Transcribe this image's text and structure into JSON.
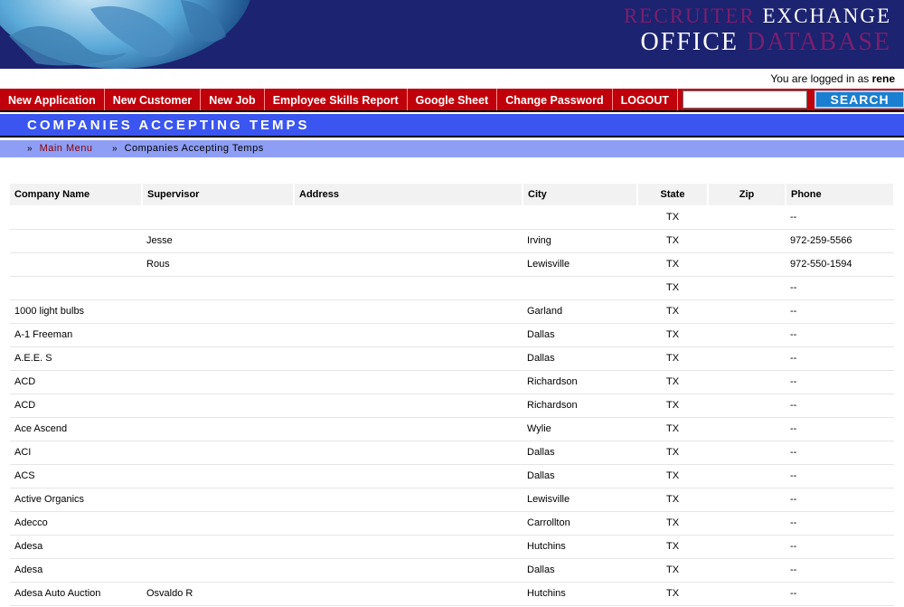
{
  "brand": {
    "line1_a": "RECRUITER",
    "line1_b": "EXCHANGE",
    "line2_a": "OFFICE",
    "line2_b": "DATABASE"
  },
  "login": {
    "prefix": "You are logged in as",
    "user": "rene"
  },
  "nav": {
    "items": [
      "New Application",
      "New Customer",
      "New Job",
      "Employee Skills Report",
      "Google Sheet",
      "Change Password",
      "LOGOUT"
    ],
    "search_value": "",
    "search_button": "SEARCH"
  },
  "page": {
    "title": "COMPANIES ACCEPTING TEMPS"
  },
  "breadcrumb": {
    "main": "Main Menu",
    "current": "Companies Accepting Temps"
  },
  "colors": {
    "header": "#1c2370",
    "nav": "#c0000a",
    "title_bar": "#3a55f0",
    "breadcrumb": "#8e9ef4",
    "brand_accent": "#7a1f6e"
  },
  "table": {
    "headers": [
      "Company Name",
      "Supervisor",
      "Address",
      "City",
      "State",
      "Zip",
      "Phone"
    ],
    "rows": [
      [
        "",
        "",
        "",
        "",
        "TX",
        "",
        "--"
      ],
      [
        "",
        "Jesse",
        "",
        "Irving",
        "TX",
        "",
        "972-259-5566"
      ],
      [
        "",
        "Rous",
        "",
        "Lewisville",
        "TX",
        "",
        "972-550-1594"
      ],
      [
        "",
        "",
        "",
        "",
        "TX",
        "",
        "--"
      ],
      [
        "1000 light bulbs",
        "",
        "",
        "Garland",
        "TX",
        "",
        "--"
      ],
      [
        "A-1 Freeman",
        "",
        "",
        "Dallas",
        "TX",
        "",
        "--"
      ],
      [
        "A.E.E. S",
        "",
        "",
        "Dallas",
        "TX",
        "",
        "--"
      ],
      [
        "ACD",
        "",
        "",
        "Richardson",
        "TX",
        "",
        "--"
      ],
      [
        "ACD",
        "",
        "",
        "Richardson",
        "TX",
        "",
        "--"
      ],
      [
        "Ace Ascend",
        "",
        "",
        "Wylie",
        "TX",
        "",
        "--"
      ],
      [
        "ACI",
        "",
        "",
        "Dallas",
        "TX",
        "",
        "--"
      ],
      [
        "ACS",
        "",
        "",
        "Dallas",
        "TX",
        "",
        "--"
      ],
      [
        "Active Organics",
        "",
        "",
        "Lewisville",
        "TX",
        "",
        "--"
      ],
      [
        "Adecco",
        "",
        "",
        "Carrollton",
        "TX",
        "",
        "--"
      ],
      [
        "Adesa",
        "",
        "",
        "Hutchins",
        "TX",
        "",
        "--"
      ],
      [
        "Adesa",
        "",
        "",
        "Dallas",
        "TX",
        "",
        "--"
      ],
      [
        "Adesa Auto Auction",
        "Osvaldo R",
        "",
        "Hutchins",
        "TX",
        "",
        "--"
      ]
    ]
  }
}
